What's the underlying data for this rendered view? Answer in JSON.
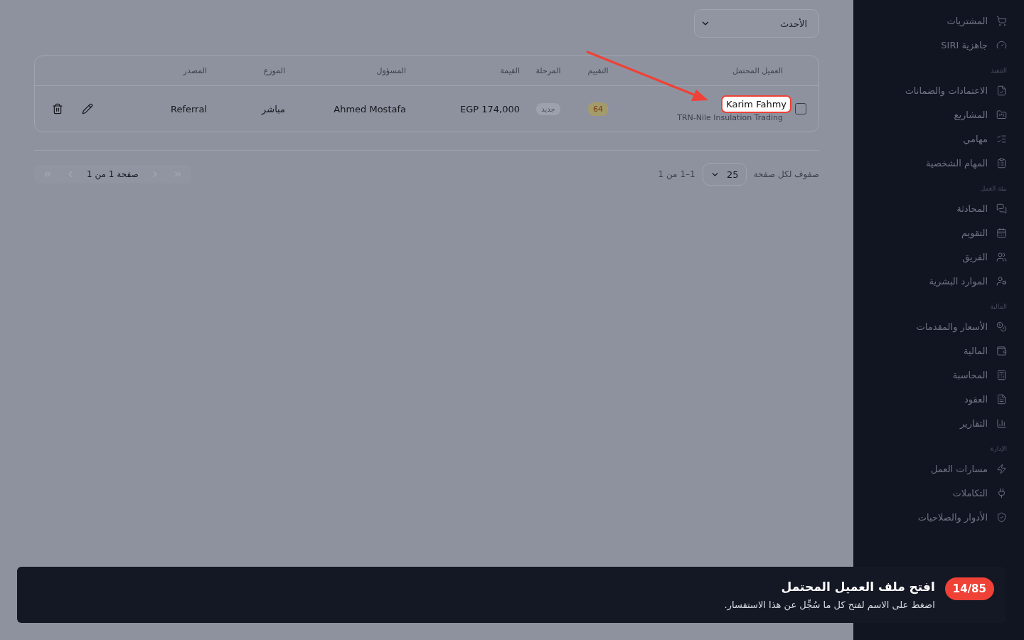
{
  "sort_select": {
    "value": "الأحدث"
  },
  "table": {
    "columns": [
      "العميل المحتمل",
      "التقييم",
      "المرحلة",
      "القيمة",
      "المسؤول",
      "الموزع",
      "المصدر"
    ],
    "rows": [
      {
        "checked": false,
        "name": "Karim Fahmy",
        "highlighted": true,
        "company": "TRN-Nile Insulation Trading",
        "score": "64",
        "stage": "جديد",
        "value": "EGP 174,000",
        "owner": "Ahmed Mostafa",
        "distributor": "مباشر",
        "source": "Referral"
      }
    ]
  },
  "pagination": {
    "rows_label": "صفوف لكل صفحة",
    "rows_per_page": "25",
    "range": "1–1 من 1",
    "page": "صفحة 1 من 1"
  },
  "sidebar": {
    "groups": [
      {
        "items": [
          {
            "label": "المشتريات"
          },
          {
            "label": "جاهزية SIRI"
          }
        ]
      },
      {
        "title": "التنفيذ",
        "items": [
          {
            "label": "الاعتمادات والضمانات"
          },
          {
            "label": "المشاريع"
          },
          {
            "label": "مهامي"
          },
          {
            "label": "المهام الشخصية"
          }
        ]
      },
      {
        "title": "بيئة العمل",
        "items": [
          {
            "label": "المحادثة"
          },
          {
            "label": "التقويم"
          },
          {
            "label": "الفريق"
          },
          {
            "label": "الموارد البشرية"
          }
        ]
      },
      {
        "title": "المالية",
        "items": [
          {
            "label": "الأسعار والمقدمات"
          },
          {
            "label": "المالية"
          },
          {
            "label": "المحاسبة"
          },
          {
            "label": "العقود"
          },
          {
            "label": "التقارير"
          }
        ]
      },
      {
        "title": "الإدارة",
        "items": [
          {
            "label": "مسارات العمل"
          },
          {
            "label": "التكاملات"
          },
          {
            "label": "الأدوار والصلاحيات"
          }
        ]
      }
    ]
  },
  "tour": {
    "step": "14/85",
    "title": "افتح ملف العميل المحتمل",
    "text": "اضغط على الاسم لفتح كل ما سُجِّل عن هذا الاستفسار."
  }
}
